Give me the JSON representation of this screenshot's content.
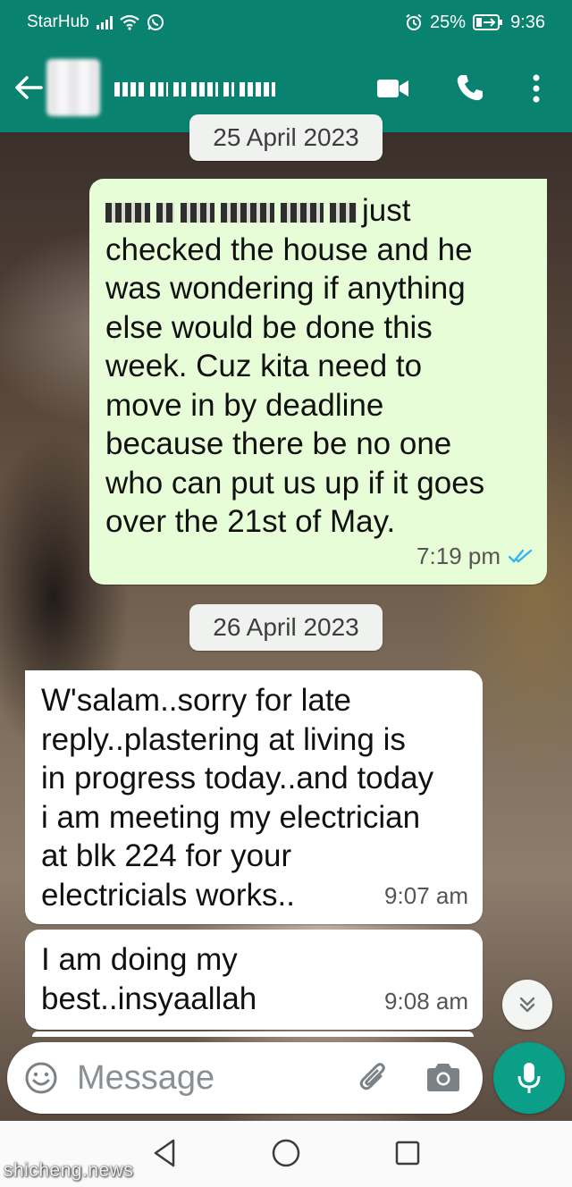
{
  "status_bar": {
    "carrier": "StarHub",
    "battery": "25%",
    "time": "9:36",
    "icons": [
      "signal-icon",
      "wifi-icon",
      "whatsapp-icon",
      "alarm-icon",
      "battery-charging-icon"
    ]
  },
  "header": {
    "contact_name_redacted": true,
    "actions": [
      "video-call-icon",
      "voice-call-icon",
      "more-menu-icon"
    ]
  },
  "chat": {
    "date_chips": [
      "25 April 2023",
      "26 April 2023"
    ],
    "messages": [
      {
        "direction": "outgoing",
        "redacted_prefix": true,
        "text": "just\nchecked the house and he\nwas wondering if anything\nelse would be done this\nweek. Cuz kita need to\nmove in by deadline\nbecause there be no one\nwho can put us up if it goes\nover the 21st of May.",
        "time": "7:19 pm",
        "status": "read"
      },
      {
        "direction": "incoming",
        "text": "W'salam..sorry for late\nreply..plastering at living is\nin progress today..and today\ni am meeting my electrician\nat blk 224 for your\nelectricials works..",
        "time": "9:07 am"
      },
      {
        "direction": "incoming",
        "text": "I am doing my\nbest..insyaallah",
        "time": "9:08 am"
      }
    ]
  },
  "composer": {
    "placeholder": "Message"
  },
  "watermark": "shicheng.news",
  "colors": {
    "header": "#0a8270",
    "outgoing_bubble": "#e7fdd8",
    "incoming_bubble": "#ffffff",
    "mic_button": "#0a9f86",
    "read_ticks": "#34b7f1"
  }
}
